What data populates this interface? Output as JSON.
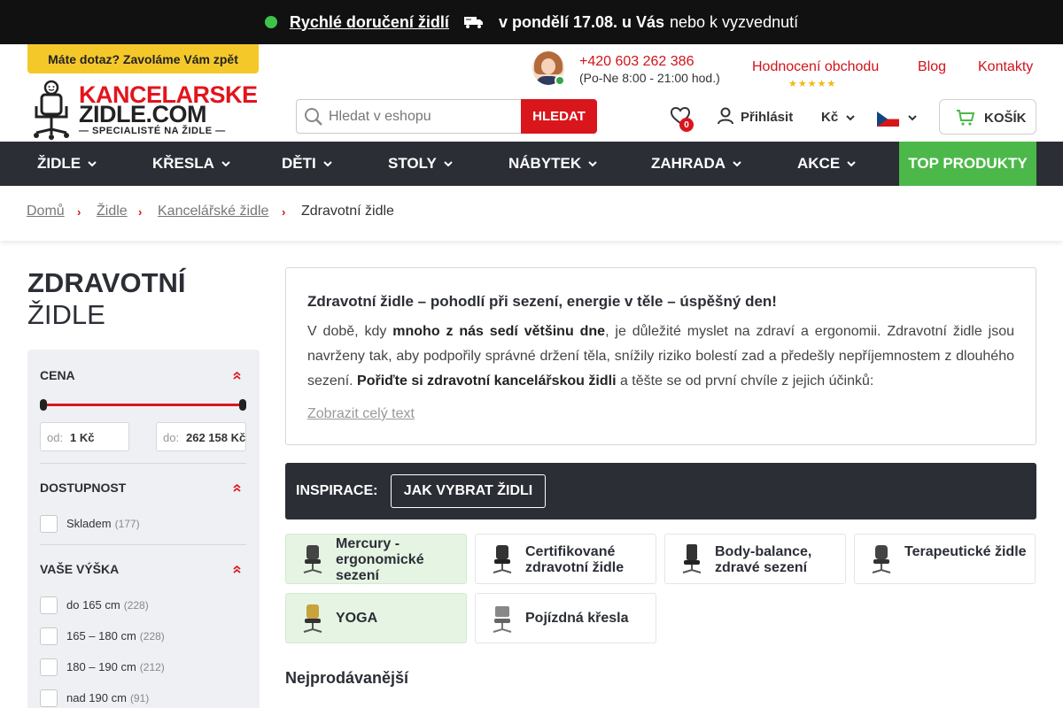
{
  "topbar": {
    "link_text": "Rychlé doručení židlí",
    "delivery_bold": "v pondělí 17.08. u Vás",
    "delivery_rest": "nebo k vyzvednutí"
  },
  "header": {
    "callback": "Máte dotaz? Zavoláme Vám zpět",
    "logo": {
      "line1": "KANCELARSKE",
      "line2": "ZIDLE.COM",
      "line3": "— SPECIALISTÉ NA ŽIDLE —"
    },
    "phone": "+420 603 262 386",
    "hours": "(Po-Ne 8:00 - 21:00 hod.)",
    "links": {
      "reviews": "Hodnocení obchodu",
      "blog": "Blog",
      "contacts": "Kontakty"
    },
    "rating_stars": "★★★★★",
    "search": {
      "placeholder": "Hledat v eshopu",
      "button": "HLEDAT"
    },
    "wishlist_count": "0",
    "login": "Přihlásit",
    "currency": "Kč",
    "cart": "KOŠÍK"
  },
  "nav": {
    "items": [
      "ŽIDLE",
      "KŘESLA",
      "DĚTI",
      "STOLY",
      "NÁBYTEK",
      "ZAHRADA",
      "AKCE"
    ],
    "top": "TOP PRODUKTY"
  },
  "breadcrumb": {
    "items": [
      "Domů",
      "Židle",
      "Kancelářské židle"
    ],
    "current": "Zdravotní židle",
    "separator": "›"
  },
  "page": {
    "title_bold": "ZDRAVOTNÍ",
    "title_rest": "ŽIDLE"
  },
  "filters": {
    "price": {
      "title": "CENA",
      "from_label": "od:",
      "from_value": "1 Kč",
      "to_label": "do:",
      "to_value": "262 158 Kč"
    },
    "availability": {
      "title": "DOSTUPNOST",
      "options": [
        {
          "label": "Skladem",
          "count": "(177)"
        }
      ]
    },
    "height": {
      "title": "VAŠE VÝŠKA",
      "options": [
        {
          "label": "do 165 cm",
          "count": "(228)"
        },
        {
          "label": "165 – 180 cm",
          "count": "(228)"
        },
        {
          "label": "180 – 190 cm",
          "count": "(212)"
        },
        {
          "label": "nad 190 cm",
          "count": "(91)"
        }
      ]
    }
  },
  "description": {
    "title": "Zdravotní židle – pohodlí při sezení, energie v těle – úspěšný den!",
    "p1": "V době, kdy ",
    "p1_bold": "mnoho z nás sedí většinu dne",
    "p2": ", je důležité myslet na zdraví a ergonomii. Zdravotní židle jsou navrženy tak, aby podpořily správné držení těla, snížily riziko bolestí zad a předešly nepříjemnostem z dlouhého sezení. ",
    "p2_bold": "Pořiďte si zdravotní kancelářskou židli",
    "p3": " a těšte se od první chvíle z jejich účinků:",
    "show_more": "Zobrazit celý text"
  },
  "inspiration": {
    "label": "INSPIRACE:",
    "button": "JAK VYBRAT ŽIDLI"
  },
  "categories": [
    {
      "label": "Mercury - ergonomické sezení"
    },
    {
      "label": "Certifikované zdravotní židle"
    },
    {
      "label": "Body-balance, zdravé sezení"
    },
    {
      "label": "Terapeutické židle"
    },
    {
      "label": "YOGA"
    },
    {
      "label": "Pojízdná křesla"
    }
  ],
  "bestsellers_title": "Nejprodávanější",
  "colors": {
    "brand_red": "#d9161c",
    "accent_yellow": "#f5c82a",
    "nav_dark": "#2b2e35",
    "top_green": "#4cb84a",
    "active_green": "#e5f4e3"
  }
}
